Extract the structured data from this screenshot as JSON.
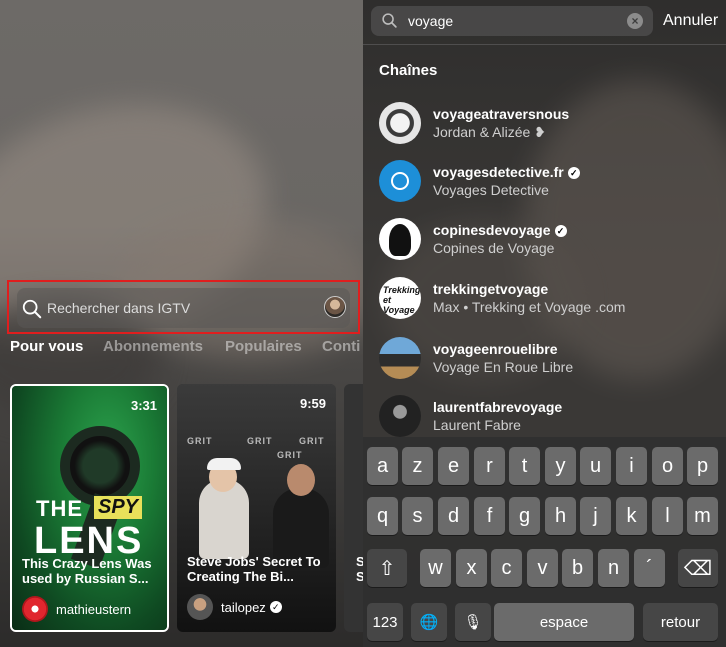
{
  "left": {
    "search": {
      "placeholder": "Rechercher dans IGTV"
    },
    "tabs": [
      "Pour vous",
      "Abonnements",
      "Populaires",
      "Conti"
    ],
    "cards": [
      {
        "duration": "3:31",
        "title": "This Crazy Lens Was used by Russian S...",
        "author": "mathieustern",
        "verified": false,
        "art": {
          "the": "THE",
          "spy": "SPY",
          "lens": "LENS"
        }
      },
      {
        "duration": "9:59",
        "title": "Steve Jobs' Secret To Creating The Bi...",
        "author": "tailopez",
        "verified": true,
        "art": {
          "grit": "GRIT"
        }
      },
      {
        "title": "S S"
      }
    ]
  },
  "right": {
    "search": {
      "value": "voyage",
      "clear_icon": "×"
    },
    "cancel": "Annuler",
    "section_title": "Chaînes",
    "channels": [
      {
        "name": "voyageatraversnous",
        "subtitle": "Jordan & Alizée ❥",
        "verified": false
      },
      {
        "name": "voyagesdetective.fr",
        "subtitle": "Voyages Detective",
        "verified": true
      },
      {
        "name": "copinesdevoyage",
        "subtitle": "Copines de Voyage",
        "verified": true
      },
      {
        "name": "trekkingetvoyage",
        "subtitle": "Max • Trekking et Voyage .com",
        "verified": false,
        "avatar_text": "Trekking et Voyage"
      },
      {
        "name": "voyageenrouelibre",
        "subtitle": "Voyage En Roue Libre",
        "verified": false
      },
      {
        "name": "laurentfabrevoyage",
        "subtitle": "Laurent Fabre",
        "verified": false
      }
    ],
    "keyboard": {
      "row1": [
        "a",
        "z",
        "e",
        "r",
        "t",
        "y",
        "u",
        "i",
        "o",
        "p"
      ],
      "row2": [
        "q",
        "s",
        "d",
        "f",
        "g",
        "h",
        "j",
        "k",
        "l",
        "m"
      ],
      "row3": [
        "w",
        "x",
        "c",
        "v",
        "b",
        "n",
        "´"
      ],
      "shift_icon": "⇧",
      "delete_icon": "⌫",
      "numbers": "123",
      "globe_icon": "🌐",
      "mic_icon": "🎙",
      "space": "espace",
      "return": "retour"
    }
  }
}
